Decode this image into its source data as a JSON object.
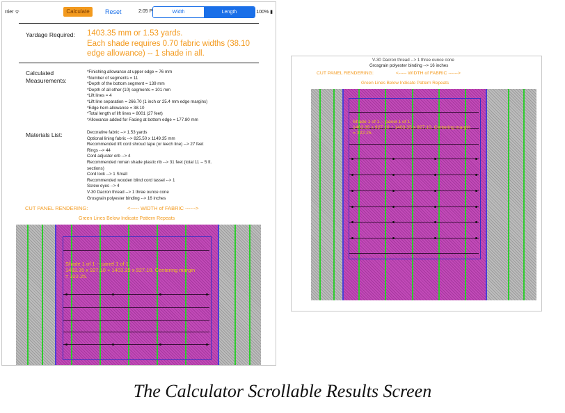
{
  "status": {
    "carrier": "rrier ᯤ",
    "time": "2:05 PM",
    "battery": "100% ▮"
  },
  "toolbar": {
    "calculate_label": "Calculate",
    "reset_label": "Reset"
  },
  "segment": {
    "width_label": "Width",
    "length_label": "Length",
    "selected": "Length"
  },
  "yardage": {
    "label": "Yardage Required:",
    "line1": "1403.35 mm or 1.53 yards.",
    "line2": "Each shade requires 0.70 fabric widths (38.10",
    "line3": "edge allowance) -- 1 shade in all."
  },
  "calculated": {
    "label_1": "Calculated",
    "label_2": "Measurements:",
    "items": [
      "*Finishing allowance at upper edge = 76 mm",
      "*Number of segments = 11",
      "*Depth of the bottom segment = 139 mm",
      "*Depth of all other (10) segments = 101 mm",
      "*Lift lines = 4",
      "*Lift line separation = 266.70 (1 inch or 25.4 mm edge margins)",
      "*Edge hem allowance = 38.10",
      "*Total length of lift lines = 8001 (27 feet)",
      "*Allowance added for Facing at bottom edge = 177.80 mm"
    ]
  },
  "materials": {
    "label": "Materials List:",
    "items": [
      "Decorative fabric --> 1.53 yards",
      "Optional lining fabric --> 825.50 x 1149.35 mm",
      "Recommended lift cord shroud tape (or leech line) --> 27 feet",
      "Rings --> 44",
      "Cord adjuster orb --> 4",
      "Recommended roman shade plastic rib --> 31 feet (total 11 -- 5 ft.",
      "sections)",
      "Cord lock --> 1 Small",
      "Recommended wooden blind cord tassel --> 1",
      "Screw eyes --> 4",
      "V-30 Dacron thread --> 1 three ounce cone",
      "Grosgrain polyester binding --> 16 inches"
    ]
  },
  "rendering": {
    "cut_panel_label": "CUT PANEL RENDERING:",
    "width_label": "<----- WIDTH of FABRIC ------>",
    "green_lines_label": "Green Lines Below Indicate Pattern Repeats",
    "shade_line1": "Shade 1 of 1 -- panel 1 of 1",
    "shade_line2": "1403.35 x 927.10 + 1403.35 x 927.10. Centering margin",
    "shade_line3": "= 222.25."
  },
  "right": {
    "top_line1": "V-30 Dacron thread --> 1 three ounce cone",
    "top_line2": "Grosgrain polyester binding --> 16 inches"
  },
  "colors": {
    "accent_orange": "#f39a1e",
    "ios_blue": "#1a6fe8",
    "fabric_pink": "#c24ab8",
    "repeat_green": "#2ecc2e",
    "shade_text": "#f0c41e"
  },
  "caption": "The Calculator Scrollable Results Screen"
}
